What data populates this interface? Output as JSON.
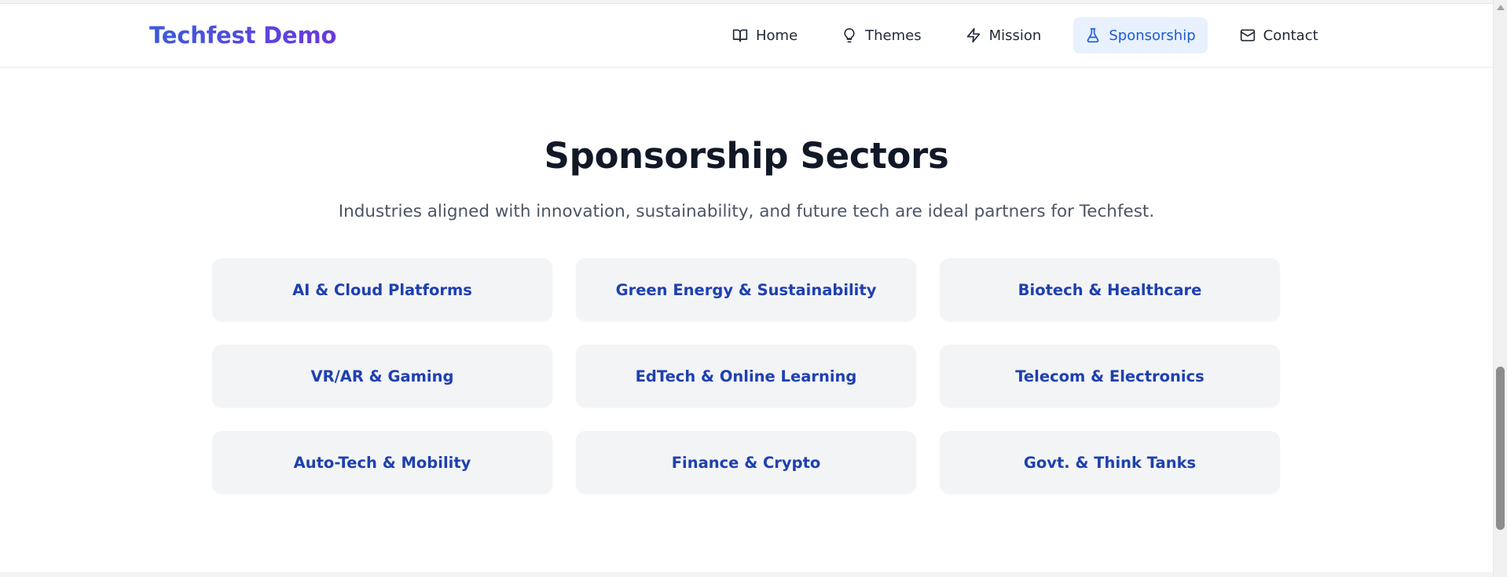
{
  "header": {
    "logo": "Techfest Demo",
    "nav": [
      {
        "label": "Home",
        "icon": "book-open-icon",
        "active": false
      },
      {
        "label": "Themes",
        "icon": "lightbulb-icon",
        "active": false
      },
      {
        "label": "Mission",
        "icon": "zap-icon",
        "active": false
      },
      {
        "label": "Sponsorship",
        "icon": "flask-icon",
        "active": true
      },
      {
        "label": "Contact",
        "icon": "mail-icon",
        "active": false
      }
    ]
  },
  "section": {
    "title": "Sponsorship Sectors",
    "subtitle": "Industries aligned with innovation, sustainability, and future tech are ideal partners for Techfest.",
    "sectors": [
      "AI & Cloud Platforms",
      "Green Energy & Sustainability",
      "Biotech & Healthcare",
      "VR/AR & Gaming",
      "EdTech & Online Learning",
      "Telecom & Electronics",
      "Auto-Tech & Mobility",
      "Finance & Crypto",
      "Govt. & Think Tanks"
    ]
  },
  "colors": {
    "logo_gradient_start": "#3b5bdb",
    "logo_gradient_end": "#6d38e0",
    "active_nav_bg": "#e8f1fd",
    "active_nav_text": "#1d5bd8",
    "card_bg": "#f3f4f6",
    "card_text": "#1e40af",
    "title_text": "#111827",
    "subtitle_text": "#4b5563"
  }
}
